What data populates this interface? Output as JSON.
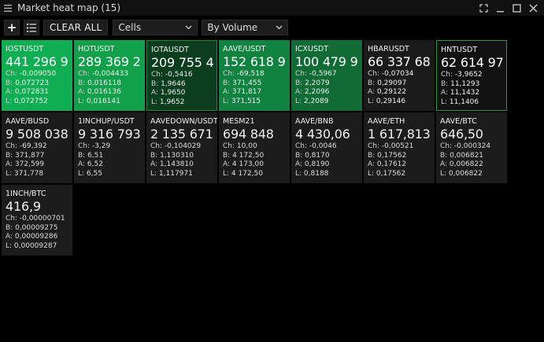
{
  "window": {
    "title": "Market heat map (15)"
  },
  "toolbar": {
    "add_label": "+",
    "clear_label": "CLEAR ALL",
    "view_select": "Cells",
    "sort_select": "By Volume"
  },
  "tiles": [
    {
      "sym": "IOSTUSDT",
      "price": "441 296 9",
      "ch": "-0,009050",
      "b": "0,072723",
      "a": "0,072831",
      "l": "0,072752"
    },
    {
      "sym": "HOTUSDT",
      "price": "289 369 2",
      "ch": "-0,004433",
      "b": "0,016118",
      "a": "0,016136",
      "l": "0,016141"
    },
    {
      "sym": "IOTAUSDT",
      "price": "209 755 4",
      "ch": "-0,5416",
      "b": "1,9646",
      "a": "1,9650",
      "l": "1,9652"
    },
    {
      "sym": "AAVE/USDT",
      "price": "152 618 9",
      "ch": "-69,518",
      "b": "371,455",
      "a": "371,817",
      "l": "371,515"
    },
    {
      "sym": "ICXUSDT",
      "price": "100 479 9",
      "ch": "-0,5967",
      "b": "2,2079",
      "a": "2,2096",
      "l": "2,2089"
    },
    {
      "sym": "HBARUSDT",
      "price": "66 337 68",
      "ch": "-0,07034",
      "b": "0,29097",
      "a": "0,29122",
      "l": "0,29146"
    },
    {
      "sym": "HNTUSDT",
      "price": "62 614 97",
      "ch": "-3,9652",
      "b": "11,1293",
      "a": "11,1432",
      "l": "11,1406"
    },
    {
      "sym": "AAVE/BUSD",
      "price": "9 508 038",
      "ch": "-69,392",
      "b": "371,877",
      "a": "372,599",
      "l": "371,778"
    },
    {
      "sym": "1INCHUP/USDT",
      "price": "9 316 793",
      "ch": "-3,29",
      "b": "6,51",
      "a": "6,52",
      "l": "6,55"
    },
    {
      "sym": "AAVEDOWN/USDT",
      "price": "2 135 671",
      "ch": "-0,104029",
      "b": "1,130310",
      "a": "1,143810",
      "l": "1,117971"
    },
    {
      "sym": "MESM21",
      "price": "694 848",
      "ch": "10,00",
      "b": "4 172,50",
      "a": "4 173,00",
      "l": "4 172,50"
    },
    {
      "sym": "AAVE/BNB",
      "price": "4 430,06",
      "ch": "-0,0046",
      "b": "0,8170",
      "a": "0,8190",
      "l": "0,8188"
    },
    {
      "sym": "AAVE/ETH",
      "price": "1 617,813",
      "ch": "-0,00521",
      "b": "0,17562",
      "a": "0,17612",
      "l": "0,17562"
    },
    {
      "sym": "AAVE/BTC",
      "price": "646,50",
      "ch": "-0,000324",
      "b": "0,006821",
      "a": "0,006822",
      "l": "0,006822"
    },
    {
      "sym": "1INCH/BTC",
      "price": "416,9",
      "ch": "-0,00000701",
      "b": "0,00009275",
      "a": "0,00009286",
      "l": "0,00009287"
    }
  ],
  "labels": {
    "ch": "Ch:",
    "b": "B:",
    "a": "A:",
    "l": "L:"
  }
}
